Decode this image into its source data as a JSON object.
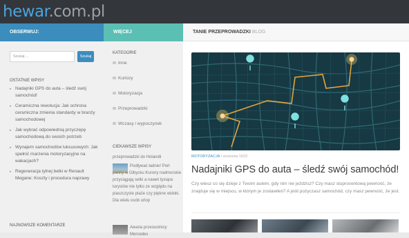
{
  "site": {
    "logo_prefix": "hewar",
    "logo_suffix": ".com.pl"
  },
  "left": {
    "header": "Obserwuj:",
    "search_placeholder": "Szukaj ...",
    "search_button": "Szukaj",
    "recent_title": "Ostatnie wpisy",
    "recent": [
      "Nadajniki GPS do auta – śledź swój samochód!",
      "Ceramiczna rewolucja: Jak ochrona ceramiczna zmienia standardy w branży samochodowej",
      "Jak wybrać odpowiednią przyczepę samochodową do swoich potrzeb",
      "Wynajem samochodów luksusowych: Jak spełnić marzenia motoryzacyjne na wakacjach?",
      "Regeneracja tylnej belki w Renault Megane: Koszty i procedura naprawy"
    ],
    "comments_title": "Najnowsze komentarze"
  },
  "middle": {
    "header": "Więcej",
    "categories_title": "Kategorie",
    "categories": [
      "Inne",
      "Kuriozy",
      "Motoryzacja",
      "Przeprowadzki",
      "Wczasy i wypoczynek"
    ],
    "interesting_title": "Ciekawsze wpisy",
    "post1_lead": "przeprowadzki do Holandii",
    "post1_text": "Podływać ładnie! Port panny w Gibycku Kurony nadmorskie przyciągają setki a nawet tysiące turystów nie tylko ze względu na piaszczyste plaże czy piękne widoki. Dla wielu osób urlop",
    "post2_text": "Awaria przeoustnicy Mercedes"
  },
  "main": {
    "header": "Tanie przeprowadzki",
    "header_sub": "Blog",
    "category": "Motoryzacja",
    "date": "/ wrzesnia 1623",
    "title": "Nadajniki GPS do auta – śledź swój samochód!",
    "excerpt": "Czy wiesz co się dzieje z Twoim autem, gdy nim nie jeździsz? Czy masz stuprocentową pewność, że znajduje się w miejscu, w którym je zostawiłeś? A jeśli pożyczasz samochód, czy masz pewność, że jest."
  },
  "colors": {
    "accent": "#3b8dbd",
    "teal": "#5bbfb3",
    "topbar": "#33363b"
  }
}
